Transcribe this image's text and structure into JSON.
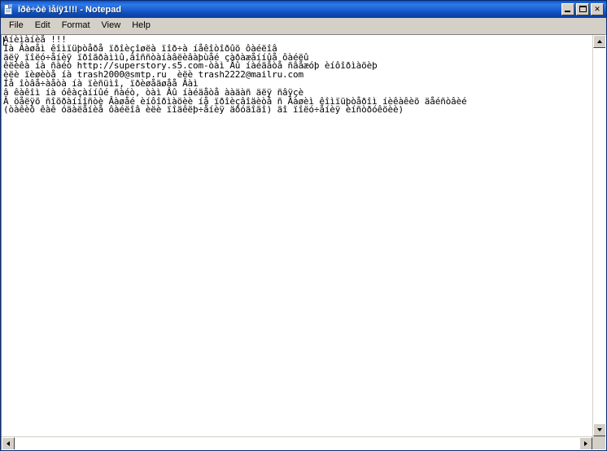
{
  "window": {
    "title": "Ïðè÷òè ìåíÿ1!!! - Notepad",
    "icon": "notepad-document-icon",
    "controls": {
      "minimize_label": "_",
      "maximize_label": "□",
      "close_label": "✕"
    }
  },
  "menu": {
    "items": [
      {
        "label": "File"
      },
      {
        "label": "Edit"
      },
      {
        "label": "Format"
      },
      {
        "label": "View"
      },
      {
        "label": "Help"
      }
    ]
  },
  "document": {
    "lines": [
      "Âíèìàíèå !!!",
      "Íà Âàøåì êîìïüþòåðå ïðîèçîøëà ïîð÷à íåêîòîðûõ ôàéëîâ",
      "äëÿ ïîëó÷åíèÿ ïðîãðàììû,âîññòàíàâëèâàþùåé çàðàæåííûå ôàéëû",
      "êëèêà íà ñàéò http://superstory.s5.com-òàì Âû íàéäåòå ñâåæóþ èíôîðìàöèþ",
      "èëè ïèøèòå íà trash2000@smtp.ru  èëè trash2222@mailru.com",
      "Íå îòâå÷àåòà íà ïèñüìî, ïðèøåäøåå Âàì",
      "â êàêîì íà óêàçàííûé ñàéò, òàì Âû íàéäåòå ààäàñ äëÿ ñâÿçè",
      "Â öåëÿõ ñîõðàííîñòè Âàøåé èíôîðìàöèè íå ïðîèçâîäèòå ñ Âàøèì êîìïüþòåðîì íèêàêèõ äåéñòâèé",
      "(òàêèõ êàê óäàëåíèå ôàéëîâ èëè ïîäêëþ÷åíèÿ äðóãîãî) äî ïîëó÷åíèÿ èíñòðóêöèè)"
    ]
  },
  "scrollbars": {
    "vertical": {
      "up_arrow": "scroll-up-arrow",
      "down_arrow": "scroll-down-arrow"
    },
    "horizontal": {
      "left_arrow": "scroll-left-arrow",
      "right_arrow": "scroll-right-arrow"
    }
  },
  "colors": {
    "title_bar_start": "#1150c8",
    "title_bar_end": "#0b3f9f",
    "window_face": "#d4d0c8",
    "client_background": "#ffffff",
    "text": "#000000"
  }
}
